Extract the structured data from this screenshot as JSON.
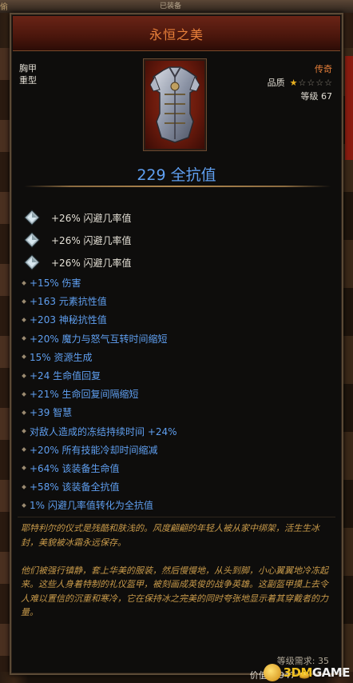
{
  "background": {
    "top_label": "已装备",
    "corner_glyph": "偷"
  },
  "tooltip": {
    "title": "永恒之美",
    "slot": "胸甲",
    "weight_class": "重型",
    "rarity": "传奇",
    "quality_label": "品质",
    "quality_stars": 1,
    "quality_max": 5,
    "item_level": "等级 67",
    "item_icon": "chest-armor-icon",
    "main_stat": "229 全抗值",
    "sockets": [
      {
        "gem_icon": "diamond-gem-icon",
        "text": "+26% 闪避几率值"
      },
      {
        "gem_icon": "diamond-gem-icon",
        "text": "+26% 闪避几率值"
      },
      {
        "gem_icon": "diamond-gem-icon",
        "text": "+26% 闪避几率值"
      }
    ],
    "affixes": [
      "+15% 伤害",
      "+163 元素抗性值",
      "+203 神秘抗性值",
      "+20% 魔力与怒气互转时间缩短",
      "15% 资源生成",
      "+24 生命值回复",
      "+21% 生命回复间隔缩短",
      "+39 智慧",
      "对敌人造成的冻结持续时间 +24%",
      "+20% 所有技能冷却时间缩减",
      "+64% 该装备生命值",
      "+58% 该装备全抗值",
      "1% 闪避几率值转化为全抗值"
    ],
    "lore": [
      "耶特利尔的仪式是残酷和肤浅的。风度翩翩的年轻人被从家中绑架，活生生冰封，美貌被冰霜永远保存。",
      "他们被强行镇静，套上华美的服装，然后慢慢地，从头到脚，小心翼翼地冷冻起来。这些人身着特制的礼仪盔甲，被刻画成英俊的战争英雄。这副盔甲摸上去令人难以置信的沉重和寒冷，它在保持冰之完美的同时夸张地显示着其穿戴者的力量。"
    ],
    "level_requirement": "等级需求: 35",
    "price": "价值: 3947",
    "currency_icon": "gold-coins-icon"
  },
  "watermark": {
    "prefix": "3DM",
    "suffix": "GAME"
  },
  "colors": {
    "legendary": "#e8803a",
    "affix_blue": "#5f9ff0",
    "lore_gold": "#c89a4a",
    "star_filled": "#e8b020"
  }
}
